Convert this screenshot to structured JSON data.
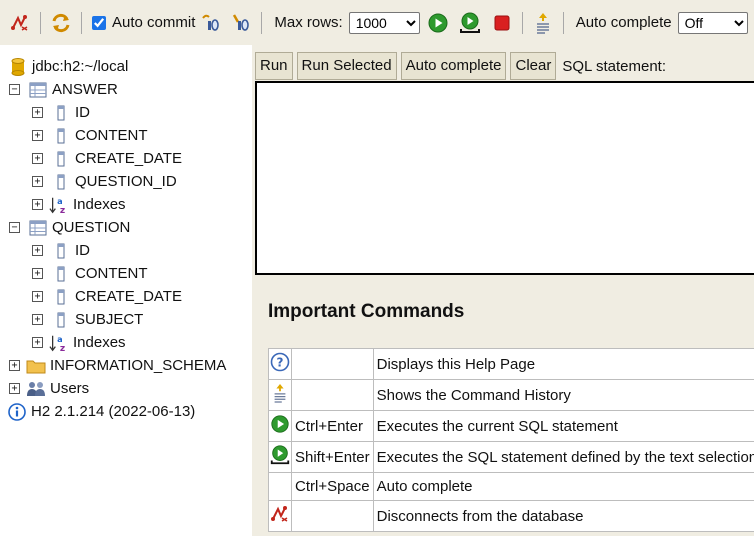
{
  "toolbar": {
    "auto_commit_label": "Auto commit",
    "auto_commit_checked": true,
    "max_rows_label": "Max rows:",
    "max_rows_value": "1000",
    "auto_complete_label": "Auto complete",
    "auto_complete_value": "Off",
    "icons": [
      "disconnect-icon",
      "refresh-icon",
      "rollback-icon",
      "commit-icon",
      "run-icon",
      "run-selected-icon",
      "stop-icon",
      "history-icon"
    ]
  },
  "tree": {
    "connection": "jdbc:h2:~/local",
    "tables": [
      {
        "name": "ANSWER",
        "columns": [
          "ID",
          "CONTENT",
          "CREATE_DATE",
          "QUESTION_ID"
        ],
        "indexes_label": "Indexes"
      },
      {
        "name": "QUESTION",
        "columns": [
          "ID",
          "CONTENT",
          "CREATE_DATE",
          "SUBJECT"
        ],
        "indexes_label": "Indexes"
      }
    ],
    "information_schema": "INFORMATION_SCHEMA",
    "users": "Users",
    "version": "H2 2.1.214 (2022-06-13)"
  },
  "editor": {
    "run_label": "Run",
    "run_selected_label": "Run Selected",
    "auto_complete_label": "Auto complete",
    "clear_label": "Clear",
    "sql_statement_label": "SQL statement:",
    "sql_value": ""
  },
  "help": {
    "title": "Important Commands",
    "rows": [
      {
        "icon": "help-icon",
        "key": "",
        "desc": "Displays this Help Page"
      },
      {
        "icon": "history-icon",
        "key": "",
        "desc": "Shows the Command History"
      },
      {
        "icon": "run-icon",
        "key": "Ctrl+Enter",
        "desc": "Executes the current SQL statement"
      },
      {
        "icon": "run-selected-icon",
        "key": "Shift+Enter",
        "desc": "Executes the SQL statement defined by the text selection"
      },
      {
        "icon": "",
        "key": "Ctrl+Space",
        "desc": "Auto complete"
      },
      {
        "icon": "disconnect-icon",
        "key": "",
        "desc": "Disconnects from the database"
      }
    ]
  },
  "colors": {
    "toolbar_bg": "#f0ede2",
    "run_green": "#2e9a2e",
    "stop_red": "#d92020",
    "disconnect_red": "#c2261c",
    "db_yellow": "#e0a800",
    "folder_yellow": "#f2c14e",
    "info_blue": "#1e63c9"
  }
}
